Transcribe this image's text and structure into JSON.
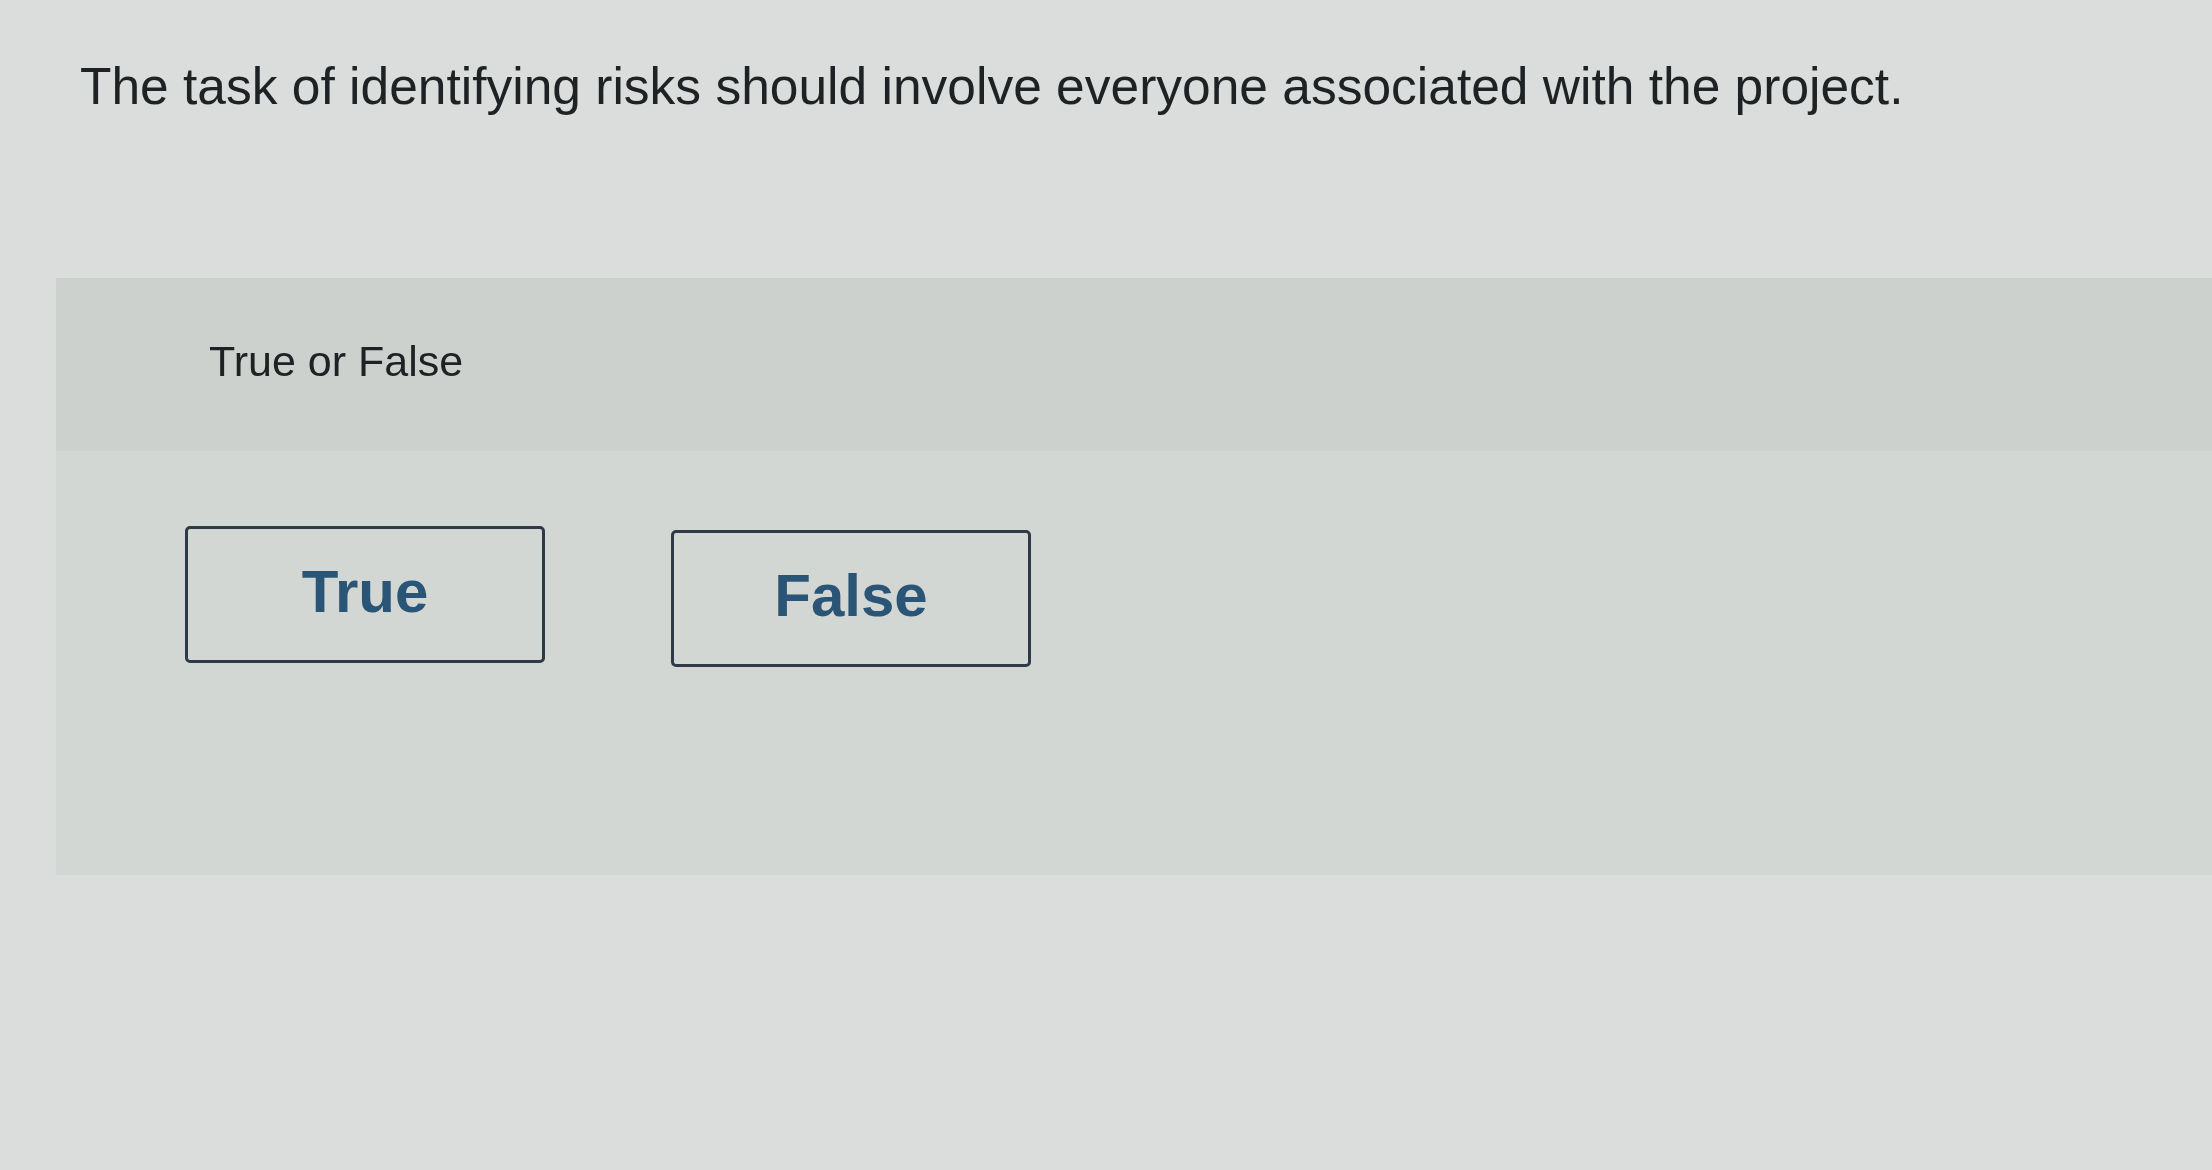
{
  "question": {
    "text": "The task of identifying risks should involve everyone associated with the project."
  },
  "answer_panel": {
    "prompt": "True or False",
    "options": [
      {
        "label": "True",
        "selected": false
      },
      {
        "label": "False",
        "selected": false
      }
    ]
  }
}
